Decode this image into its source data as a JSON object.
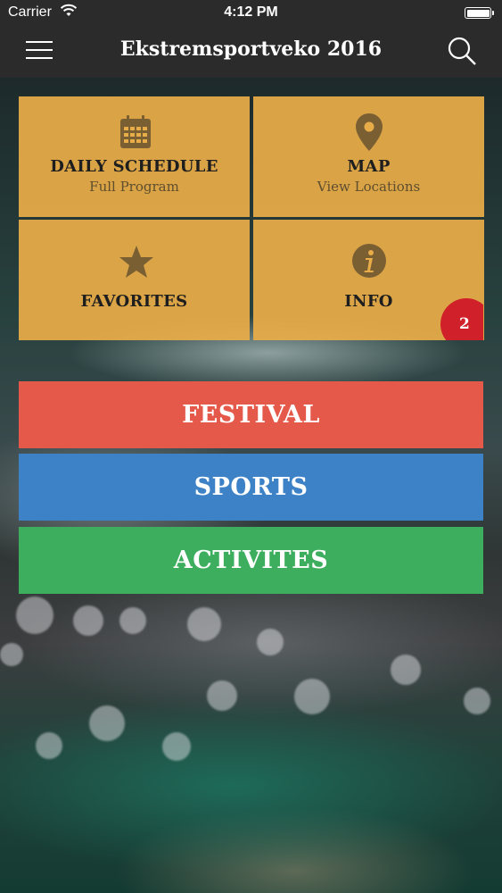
{
  "status_bar": {
    "carrier": "Carrier",
    "time": "4:12 PM"
  },
  "nav": {
    "title": "Ekstremsportveko 2016",
    "menu_icon": "hamburger-menu-icon",
    "search_icon": "search-icon"
  },
  "tiles": [
    {
      "title": "DAILY SCHEDULE",
      "subtitle": "Full Program",
      "icon": "calendar-icon"
    },
    {
      "title": "MAP",
      "subtitle": "View Locations",
      "icon": "map-pin-icon"
    },
    {
      "title": "FAVORITES",
      "subtitle": "",
      "icon": "star-icon"
    },
    {
      "title": "INFO",
      "subtitle": "",
      "icon": "info-icon",
      "badge": "2"
    }
  ],
  "buttons": [
    {
      "label": "FESTIVAL",
      "color": "#e5594a"
    },
    {
      "label": "SPORTS",
      "color": "#3d82c7"
    },
    {
      "label": "ACTIVITES",
      "color": "#3cae5d"
    }
  ],
  "colors": {
    "bar": "#2b2b2b",
    "tile": "#e8ac48",
    "tile_icon": "#7a5f33",
    "badge": "#d0202a"
  }
}
